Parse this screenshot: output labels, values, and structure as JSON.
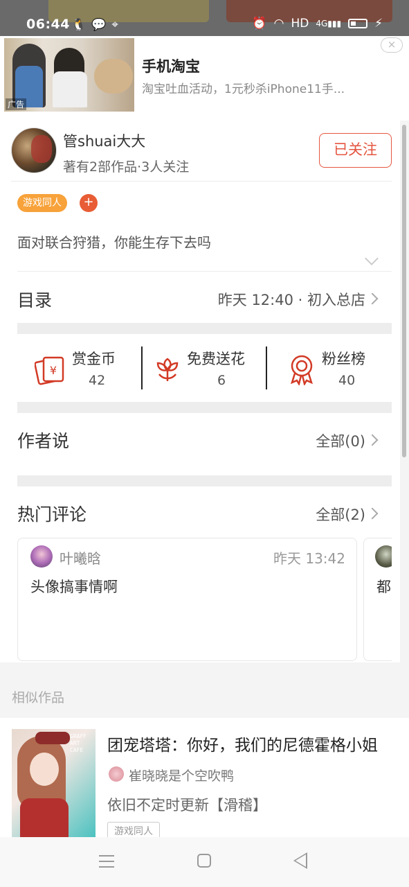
{
  "status_bar": {
    "time": "06:44",
    "left_icons": [
      "qq-icon",
      "wechat-icon",
      "location-icon"
    ],
    "network": "HD",
    "signal": "4G"
  },
  "ad": {
    "title": "手机淘宝",
    "desc": "淘宝吐血活动，1元秒杀iPhone11手...",
    "ad_tag": "广告",
    "close": "×"
  },
  "author": {
    "name": "管shuai大大",
    "stats": "著有2部作品·3人关注",
    "follow_label": "已关注"
  },
  "work": {
    "tag": "游戏同人",
    "tag_add": "+",
    "description": "面对联合狩猎，你能生存下去吗"
  },
  "catalog": {
    "title": "目录",
    "meta": "昨天 12:40 · 初入总店"
  },
  "stats": {
    "reward": {
      "label": "赏金币",
      "value": "42"
    },
    "flower": {
      "label": "免费送花",
      "value": "6"
    },
    "fans": {
      "label": "粉丝榜",
      "value": "40"
    }
  },
  "author_says": {
    "title": "作者说",
    "meta": "全部(0)"
  },
  "hot_comments": {
    "title": "热门评论",
    "meta": "全部(2)",
    "items": [
      {
        "name": "叶曦晗",
        "time": "昨天 13:42",
        "text": "头像搞事情啊"
      },
      {
        "text": "都"
      }
    ]
  },
  "similar": {
    "heading": "相似作品",
    "book": {
      "title": "团宠塔塔：你好，我们的尼德霍格小姐",
      "author": "崔晓晓是个空吹鸭",
      "desc": "依旧不定时更新【滑稽】",
      "tag": "游戏同人",
      "cover_text": "GRAFF\nART\nCAFE"
    }
  },
  "colors": {
    "accent": "#e4553f",
    "tag_orange": "#f7a23a"
  }
}
